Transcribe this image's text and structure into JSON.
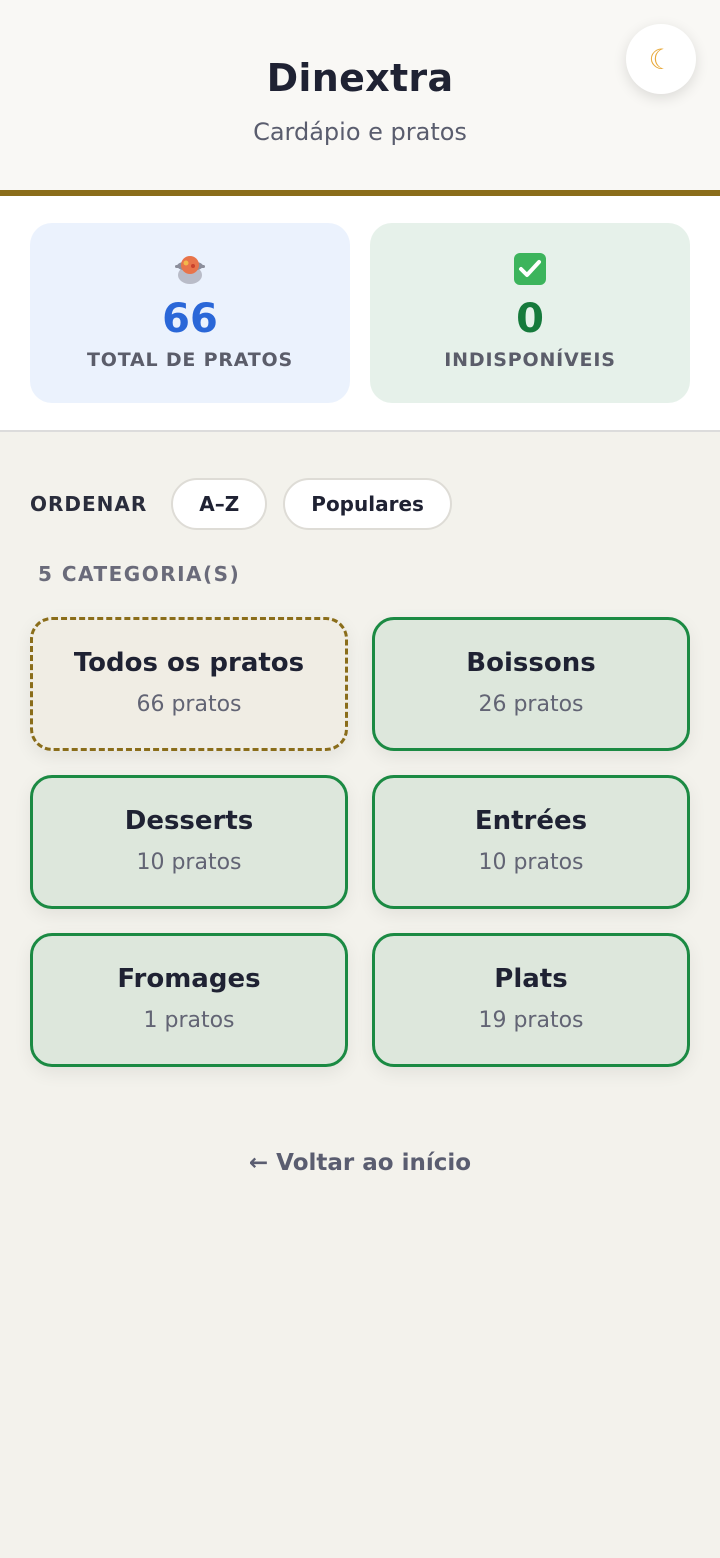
{
  "header": {
    "title": "Dinextra",
    "subtitle": "Cardápio e pratos",
    "theme_icon": "moon-icon",
    "theme_glyph": "☾"
  },
  "stats": [
    {
      "icon": "pot-of-food-icon",
      "value": "66",
      "label": "TOTAL DE PRATOS",
      "color": "#2a67d8"
    },
    {
      "icon": "check-mark-icon",
      "value": "0",
      "label": "INDISPONÍVEIS",
      "color": "#167a3c"
    }
  ],
  "sort": {
    "label": "ORDENAR",
    "options": [
      "A–Z",
      "Populares"
    ]
  },
  "categories": {
    "count_label": "5 CATEGORIA(S)",
    "items": [
      {
        "name": "Todos os pratos",
        "count": "66 pratos"
      },
      {
        "name": "Boissons",
        "count": "26 pratos"
      },
      {
        "name": "Desserts",
        "count": "10 pratos"
      },
      {
        "name": "Entrées",
        "count": "10 pratos"
      },
      {
        "name": "Fromages",
        "count": "1 pratos"
      },
      {
        "name": "Plats",
        "count": "19 pratos"
      }
    ]
  },
  "footer": {
    "back_label": "← Voltar ao início"
  },
  "colors": {
    "accent": "#8a6d1a",
    "category_border": "#1b8a43",
    "blue": "#2a67d8",
    "green": "#167a3c"
  }
}
